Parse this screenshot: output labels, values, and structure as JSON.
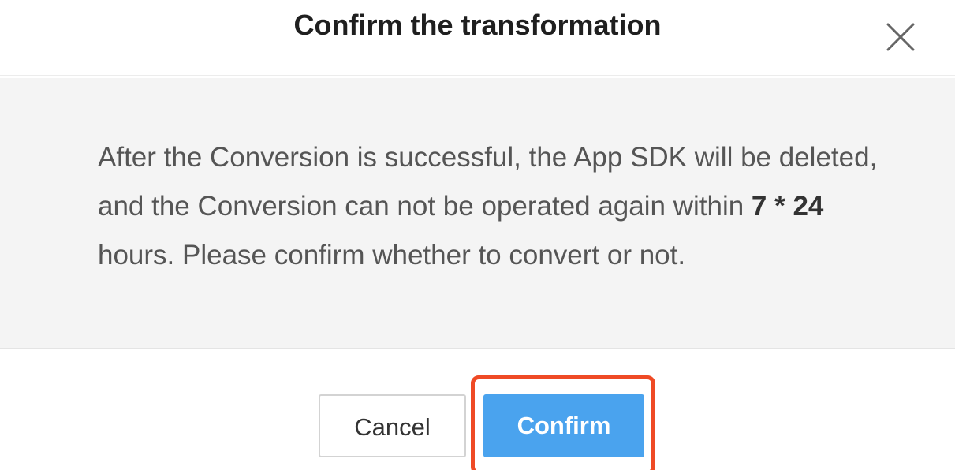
{
  "dialog": {
    "title": "Confirm the transformation",
    "close_icon": "close-icon",
    "message": {
      "before": "After the Conversion is successful, the App SDK will be deleted, and the Conversion can not be operated again within ",
      "emphasis": "7 * 24",
      "after": " hours. Please confirm whether to convert or not."
    },
    "buttons": {
      "cancel_label": "Cancel",
      "confirm_label": "Confirm"
    }
  },
  "colors": {
    "confirm_button": "#4aa3ee",
    "highlight_border": "#ef4a25",
    "body_background": "#f4f4f4"
  }
}
